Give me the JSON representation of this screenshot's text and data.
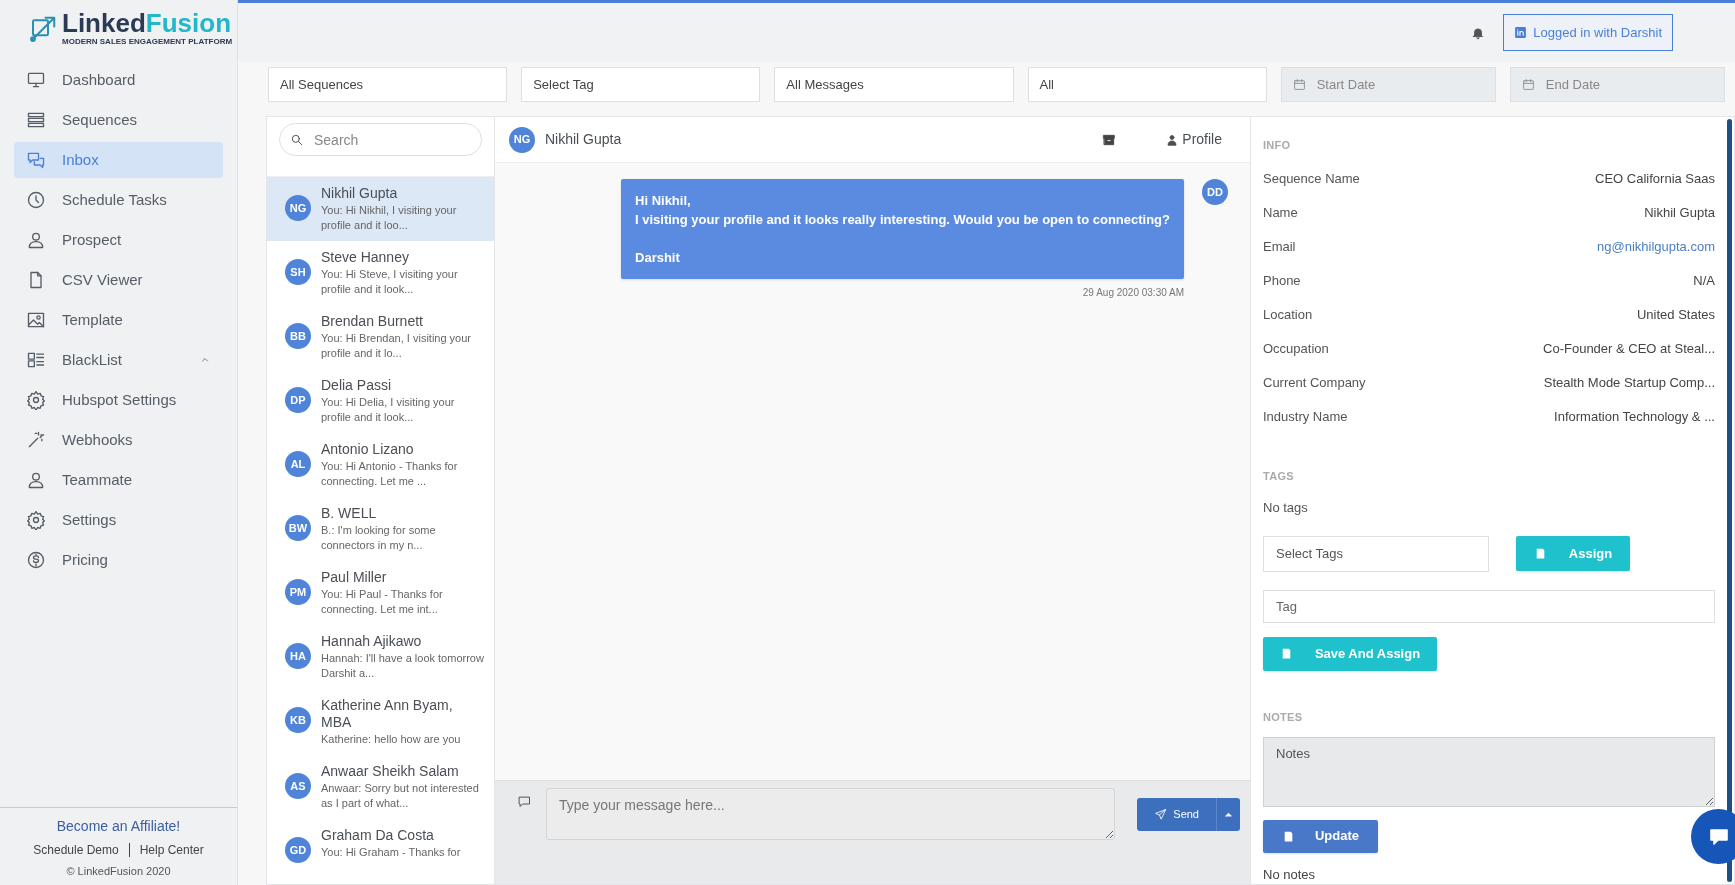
{
  "logo": {
    "name_start": "Linked",
    "name_end": "Fusion",
    "tagline": "MODERN SALES ENGAGEMENT PLATFORM"
  },
  "sidebar": {
    "items": [
      {
        "label": "Dashboard",
        "selected": false
      },
      {
        "label": "Sequences",
        "selected": false
      },
      {
        "label": "Inbox",
        "selected": true
      },
      {
        "label": "Schedule Tasks",
        "selected": false
      },
      {
        "label": "Prospect",
        "selected": false
      },
      {
        "label": "CSV Viewer",
        "selected": false
      },
      {
        "label": "Template",
        "selected": false
      },
      {
        "label": "BlackList",
        "selected": false,
        "expanded": true
      },
      {
        "label": "Hubspot Settings",
        "selected": false
      },
      {
        "label": "Webhooks",
        "selected": false
      },
      {
        "label": "Teammate",
        "selected": false
      },
      {
        "label": "Settings",
        "selected": false
      },
      {
        "label": "Pricing",
        "selected": false
      }
    ],
    "affiliate": "Become an Affiliate!",
    "links": [
      "Schedule Demo",
      "Help Center"
    ],
    "copyright": "© LinkedFusion 2020"
  },
  "topbar": {
    "login_button": "Logged in with Darshit"
  },
  "filters": [
    {
      "kind": "select",
      "value": "All Sequences"
    },
    {
      "kind": "select",
      "value": "Select Tag"
    },
    {
      "kind": "select",
      "value": "All Messages"
    },
    {
      "kind": "select",
      "value": "All"
    },
    {
      "kind": "date",
      "placeholder": "Start Date"
    },
    {
      "kind": "date",
      "placeholder": "End Date"
    }
  ],
  "conversations": {
    "search_placeholder": "Search",
    "items": [
      {
        "initials": "NG",
        "name": "Nikhil Gupta",
        "preview": "You: Hi Nikhil, I visiting your profile and it loo...",
        "selected": true
      },
      {
        "initials": "SH",
        "name": "Steve Hanney",
        "preview": "You: Hi Steve, I visiting your profile and it look...",
        "selected": false
      },
      {
        "initials": "BB",
        "name": "Brendan Burnett",
        "preview": "You: Hi Brendan, I visiting your profile and it lo...",
        "selected": false
      },
      {
        "initials": "DP",
        "name": "Delia Passi",
        "preview": "You: Hi Delia, I visiting your profile and it look...",
        "selected": false
      },
      {
        "initials": "AL",
        "name": "Antonio Lizano",
        "preview": "You: Hi Antonio - Thanks for connecting. Let me ...",
        "selected": false
      },
      {
        "initials": "BW",
        "name": "B. WELL",
        "preview": "B.: I'm looking for some connectors in my n...",
        "selected": false
      },
      {
        "initials": "PM",
        "name": "Paul Miller",
        "preview": "You: Hi Paul - Thanks for connecting. Let me int...",
        "selected": false
      },
      {
        "initials": "HA",
        "name": "Hannah Ajikawo",
        "preview": "Hannah: I'll have a look tomorrow Darshit a...",
        "selected": false
      },
      {
        "initials": "KB",
        "name": "Katherine Ann Byam, MBA",
        "preview": "Katherine: hello how are you",
        "selected": false
      },
      {
        "initials": "AS",
        "name": "Anwaar Sheikh Salam",
        "preview": "Anwaar: Sorry but not interested as I part of what...",
        "selected": false
      },
      {
        "initials": "GD",
        "name": "Graham Da Costa",
        "preview": "You: Hi Graham - Thanks for",
        "selected": false
      }
    ]
  },
  "chat": {
    "initials": "NG",
    "name": "Nikhil Gupta",
    "profile_label": "Profile",
    "messages": [
      {
        "text": "Hi Nikhil,\nI visiting your profile and it looks really interesting. Would you be open to connecting?\n\nDarshit",
        "avatar": "DD",
        "time": "29 Aug 2020 03:30 AM"
      }
    ],
    "composer_placeholder": "Type your message here...",
    "send_label": "Send"
  },
  "details": {
    "info_heading": "INFO",
    "fields": [
      {
        "kind": "text",
        "label": "Sequence Name",
        "value": "CEO California Saas"
      },
      {
        "kind": "text",
        "label": "Name",
        "value": "Nikhil Gupta"
      },
      {
        "kind": "link",
        "label": "Email",
        "value": "ng@nikhilgupta.com"
      },
      {
        "kind": "text",
        "label": "Phone",
        "value": "N/A"
      },
      {
        "kind": "text",
        "label": "Location",
        "value": "United States"
      },
      {
        "kind": "text",
        "label": "Occupation",
        "value": "Co-Founder & CEO at Steal..."
      },
      {
        "kind": "text",
        "label": "Current Company",
        "value": "Stealth Mode Startup Comp..."
      },
      {
        "kind": "text",
        "label": "Industry Name",
        "value": "Information Technology & ..."
      }
    ],
    "tags_heading": "TAGS",
    "tags_empty": "No tags",
    "select_tags_placeholder": "Select Tags",
    "assign_label": "Assign",
    "tag_placeholder": "Tag",
    "save_assign_label": "Save And Assign",
    "notes_heading": "NOTES",
    "notes_placeholder": "Notes",
    "update_label": "Update",
    "notes_empty": "No notes"
  }
}
